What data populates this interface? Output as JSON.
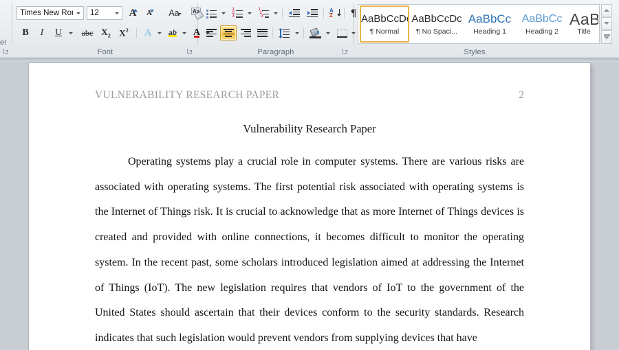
{
  "ribbon": {
    "left_stub": {
      "label": "er",
      "launcher": "dialog-launcher"
    },
    "font_group": {
      "label": "Font",
      "font_name": {
        "value": "Times New Rom",
        "name": "font-name-combo"
      },
      "font_size": {
        "value": "12",
        "name": "font-size-combo"
      },
      "grow_font": "A",
      "shrink_font": "A",
      "change_case": "Aa",
      "clear_formatting": "clear-formatting-icon",
      "bold": "B",
      "italic": "I",
      "underline": "U",
      "strikethrough": "abc",
      "subscript": "X",
      "superscript": "X",
      "text_effects": "A",
      "highlight": "ab",
      "font_color": "A"
    },
    "paragraph_group": {
      "label": "Paragraph",
      "bullets": "bullets-icon",
      "numbering": "numbering-icon",
      "multilevel_list": "multilevel-list-icon",
      "decrease_indent": "decrease-indent-icon",
      "increase_indent": "increase-indent-icon",
      "sort": "sort-icon",
      "show_marks": "¶",
      "align_left": "align-left-icon",
      "align_center": "align-center-icon",
      "align_right": "align-right-icon",
      "justify": "justify-icon",
      "line_spacing": "line-spacing-icon",
      "shading": "shading-icon",
      "borders": "borders-icon",
      "active_alignment": "align_center"
    },
    "styles_group": {
      "label": "Styles",
      "selected": "Normal",
      "items": [
        {
          "preview": "AaBbCcDc",
          "name": "¶ Normal",
          "kind": "normal"
        },
        {
          "preview": "AaBbCcDc",
          "name": "¶ No Spaci...",
          "kind": "normal"
        },
        {
          "preview": "AaBbCс",
          "name": "Heading 1",
          "kind": "h1"
        },
        {
          "preview": "AaBbCc",
          "name": "Heading 2",
          "kind": "h2"
        },
        {
          "preview": "AaBІ",
          "name": "Title",
          "kind": "title"
        }
      ],
      "scroll_up": "scroll-up-icon",
      "scroll_down": "scroll-down-icon",
      "more_styles": "more-styles-icon"
    }
  },
  "document": {
    "header_text": "VULNERABILITY RESEARCH PAPER",
    "page_number": "2",
    "title": "Vulnerability Research Paper",
    "body_paragraph": "Operating systems play a crucial role in computer systems. There are various risks are associated with operating systems. The first potential risk associated with operating systems is the Internet of Things risk. It is crucial to acknowledge that as more Internet of Things devices is created and provided with online connections, it becomes difficult to monitor the operating system. In the recent past, some scholars introduced legislation aimed at addressing the Internet of Things (IoT). The new legislation requires that vendors of IoT to the government of the United States should ascertain that their devices conform to the security standards. Research indicates that such legislation would prevent vendors from supplying devices that have"
  },
  "colors": {
    "accent_selected": "#e8b44a",
    "ribbon_bg": "#eaedf0",
    "canvas_bg": "#c9ced3",
    "page_bg": "#ffffff",
    "header_text": "#9a9a9a",
    "heading1": "#2e74b5",
    "heading2": "#5b9bd5"
  }
}
